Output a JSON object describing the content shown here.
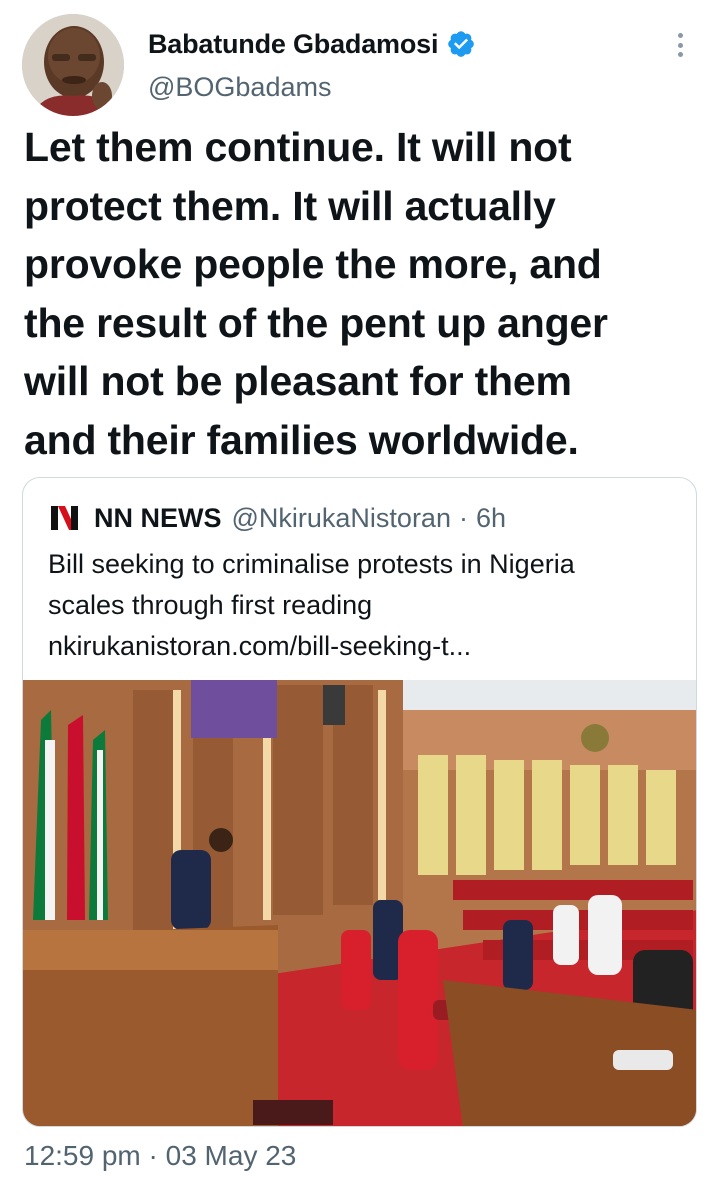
{
  "author": {
    "name": "Babatunde Gbadamosi",
    "handle": "@BOGbadams",
    "verified_icon": "verified-badge-icon"
  },
  "tweet": {
    "lines": [
      "Let them continue. It will not",
      "protect them. It will actually",
      "provoke people the more, and",
      "the result of the pent up anger",
      "will not be pleasant for them",
      "and their families worldwide."
    ],
    "timestamp": "12:59 pm · 03 May 23"
  },
  "quoted": {
    "name": "NN NEWS",
    "handle": "@NkirukaNistoran",
    "separator": "·",
    "time": "6h",
    "text_lines": [
      "Bill seeking to criminalise protests in Nigeria",
      "scales through first reading",
      "nkirukanistoran.com/bill-seeking-t..."
    ],
    "logo_icon": "nn-news-logo-icon",
    "logo_letter": "N"
  },
  "colors": {
    "text": "#0f1419",
    "secondary": "#536471",
    "verified": "#1d9bf0",
    "border": "#cfd9de",
    "logo_red": "#d6101b"
  }
}
